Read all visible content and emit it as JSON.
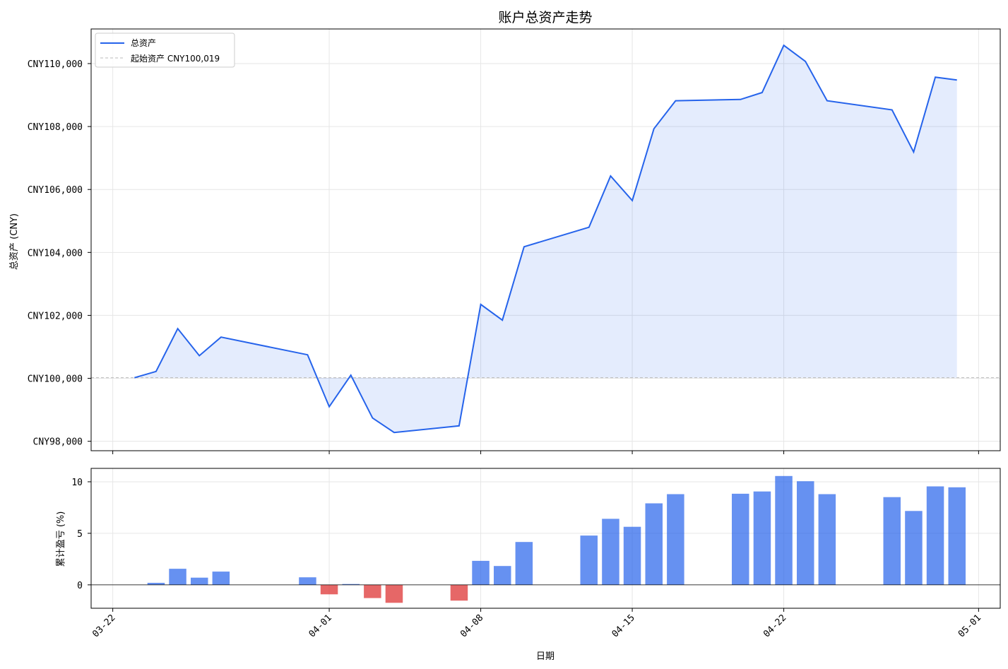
{
  "chart_data": [
    {
      "type": "line",
      "title": "账户总资产走势",
      "ylabel": "总资产 (CNY)",
      "ylim": [
        97700,
        111100
      ],
      "xlim": [
        "2025-03-21",
        "2025-05-02"
      ],
      "grid": true,
      "legend_position": "top-left",
      "yticks": [
        98000,
        100000,
        102000,
        104000,
        106000,
        108000,
        110000
      ],
      "ytick_labels": [
        "CNY98,000",
        "CNY100,000",
        "CNY102,000",
        "CNY104,000",
        "CNY106,000",
        "CNY108,000",
        "CNY110,000"
      ],
      "series": [
        {
          "name": "总资产",
          "color": "#2563eb",
          "fill_color": "#2563eb",
          "x": [
            "2025-03-23",
            "2025-03-24",
            "2025-03-25",
            "2025-03-26",
            "2025-03-27",
            "2025-03-31",
            "2025-04-01",
            "2025-04-02",
            "2025-04-03",
            "2025-04-04",
            "2025-04-07",
            "2025-04-08",
            "2025-04-09",
            "2025-04-10",
            "2025-04-13",
            "2025-04-14",
            "2025-04-15",
            "2025-04-16",
            "2025-04-17",
            "2025-04-20",
            "2025-04-21",
            "2025-04-22",
            "2025-04-23",
            "2025-04-24",
            "2025-04-27",
            "2025-04-28",
            "2025-04-29",
            "2025-04-30"
          ],
          "y": [
            100019,
            100219,
            101579,
            100719,
            101309,
            100749,
            99099,
            100099,
            98739,
            98279,
            98489,
            102349,
            101849,
            104179,
            104799,
            106429,
            105649,
            107929,
            108819,
            108859,
            109079,
            110579,
            110069,
            108819,
            108529,
            107189,
            109569,
            109479
          ]
        },
        {
          "name": "起始资产 CNY100,019",
          "color": "#bbbbbb",
          "style": "dashed",
          "value": 100019
        }
      ]
    },
    {
      "type": "bar",
      "ylabel": "累计盈亏 (%)",
      "xlabel": "日期",
      "ylim": [
        -2.27,
        11.3
      ],
      "xlim": [
        "2025-03-21",
        "2025-05-02"
      ],
      "grid": true,
      "positive_color": "#2563eb",
      "negative_color": "#dc2626",
      "yticks": [
        0,
        5,
        10
      ],
      "ytick_labels": [
        "0",
        "5",
        "10"
      ],
      "xticks": [
        "2025-03-22",
        "2025-04-01",
        "2025-04-08",
        "2025-04-15",
        "2025-04-22",
        "2025-05-01"
      ],
      "xtick_labels": [
        "03-22",
        "04-01",
        "04-08",
        "04-15",
        "04-22",
        "05-01"
      ],
      "x": [
        "2025-03-24",
        "2025-03-25",
        "2025-03-26",
        "2025-03-27",
        "2025-03-31",
        "2025-04-01",
        "2025-04-02",
        "2025-04-03",
        "2025-04-04",
        "2025-04-07",
        "2025-04-08",
        "2025-04-09",
        "2025-04-10",
        "2025-04-13",
        "2025-04-14",
        "2025-04-15",
        "2025-04-16",
        "2025-04-17",
        "2025-04-20",
        "2025-04-21",
        "2025-04-22",
        "2025-04-23",
        "2025-04-24",
        "2025-04-27",
        "2025-04-28",
        "2025-04-29",
        "2025-04-30"
      ],
      "values": [
        0.2,
        1.56,
        0.7,
        1.29,
        0.73,
        -0.92,
        0.08,
        -1.28,
        -1.74,
        -1.53,
        2.33,
        1.83,
        4.16,
        4.78,
        6.41,
        5.63,
        7.91,
        8.8,
        8.84,
        9.06,
        10.56,
        10.05,
        8.8,
        8.51,
        7.17,
        9.55,
        9.46
      ]
    }
  ]
}
